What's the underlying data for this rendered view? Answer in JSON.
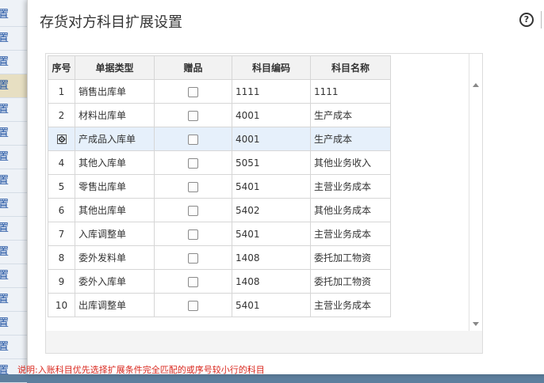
{
  "background": {
    "items": [
      "置",
      "置",
      "置",
      "置",
      "置",
      "置",
      "置",
      "置",
      "置",
      "置",
      "置",
      "置",
      "置",
      "置",
      "置",
      "置"
    ],
    "active_index": 3
  },
  "dialog": {
    "title": "存货对方科目扩展设置",
    "help_glyph": "?"
  },
  "table": {
    "headers": {
      "idx": "序号",
      "doc_type": "单据类型",
      "gift": "赠品",
      "account_code": "科目编码",
      "account_name": "科目名称"
    },
    "rows": [
      {
        "idx": "1",
        "doc_type": "销售出库单",
        "account_code": "1111",
        "account_name": "1111",
        "gift": false
      },
      {
        "idx": "2",
        "doc_type": "材料出库单",
        "account_code": "4001",
        "account_name": "生产成本",
        "gift": false
      },
      {
        "idx": "",
        "doc_type": "产成品入库单",
        "account_code": "4001",
        "account_name": "生产成本",
        "gift": false,
        "selected": true
      },
      {
        "idx": "4",
        "doc_type": "其他入库单",
        "account_code": "5051",
        "account_name": "其他业务收入",
        "gift": false
      },
      {
        "idx": "5",
        "doc_type": "零售出库单",
        "account_code": "5401",
        "account_name": "主营业务成本",
        "gift": false
      },
      {
        "idx": "6",
        "doc_type": "其他出库单",
        "account_code": "5402",
        "account_name": "其他业务成本",
        "gift": false
      },
      {
        "idx": "7",
        "doc_type": "入库调整单",
        "account_code": "5401",
        "account_name": "主营业务成本",
        "gift": false
      },
      {
        "idx": "8",
        "doc_type": "委外发料单",
        "account_code": "1408",
        "account_name": "委托加工物资",
        "gift": false
      },
      {
        "idx": "9",
        "doc_type": "委外入库单",
        "account_code": "1408",
        "account_name": "委托加工物资",
        "gift": false
      },
      {
        "idx": "10",
        "doc_type": "出库调整单",
        "account_code": "5401",
        "account_name": "主营业务成本",
        "gift": false
      }
    ]
  },
  "note": "说明:入账科目优先选择扩展条件完全匹配的或序号较小行的科目",
  "colors": {
    "note_red": "#d9261c",
    "selected_row": "#e6f0fb",
    "header_bg": "#f2f2f2"
  }
}
